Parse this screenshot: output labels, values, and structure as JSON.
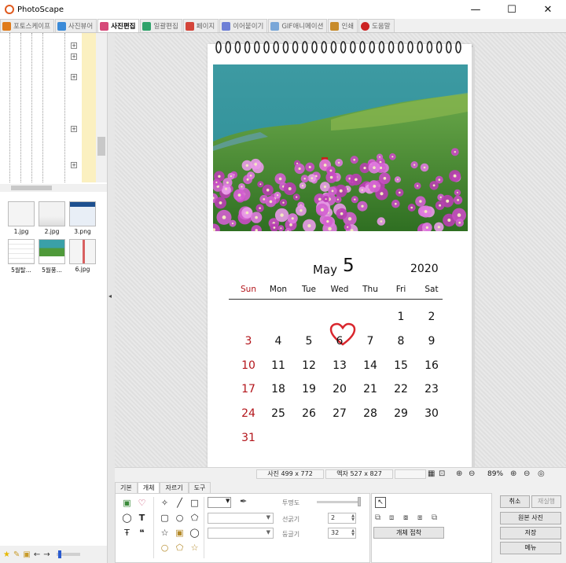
{
  "window": {
    "title": "PhotoScape",
    "controls": [
      "—",
      "☐",
      "✕"
    ]
  },
  "tabs": [
    {
      "label": "포토스케이프",
      "color": "#e07b1a"
    },
    {
      "label": "사진뷰어",
      "color": "#3b8bd8"
    },
    {
      "label": "사진편집",
      "color": "#d64a7a",
      "active": true
    },
    {
      "label": "일괄편집",
      "color": "#2fa36b"
    },
    {
      "label": "페이지",
      "color": "#d4453a"
    },
    {
      "label": "이어붙이기",
      "color": "#6d7fd6"
    },
    {
      "label": "GIF애니메이션",
      "color": "#7aa7d8"
    },
    {
      "label": "인쇄",
      "color": "#c88b2a"
    },
    {
      "label": "도움말",
      "color": "#cc2222"
    }
  ],
  "thumbnails": [
    {
      "label": "1.jpg"
    },
    {
      "label": "2.jpg"
    },
    {
      "label": "3.png"
    },
    {
      "label": "5월탈..."
    },
    {
      "label": "5월풍..."
    },
    {
      "label": "6.jpg"
    }
  ],
  "calendar": {
    "month": "May",
    "day": "5",
    "year": "2020",
    "weekdays": [
      "Sun",
      "Mon",
      "Tue",
      "Wed",
      "Thu",
      "Fri",
      "Sat"
    ],
    "weeks": [
      [
        "",
        "",
        "",
        "",
        "",
        "1",
        "2"
      ],
      [
        "3",
        "4",
        "5",
        "6",
        "7",
        "8",
        "9"
      ],
      [
        "10",
        "11",
        "12",
        "13",
        "14",
        "15",
        "16"
      ],
      [
        "17",
        "18",
        "19",
        "20",
        "21",
        "22",
        "23"
      ],
      [
        "24",
        "25",
        "26",
        "27",
        "28",
        "29",
        "30"
      ],
      [
        "31",
        "",
        "",
        "",
        "",
        "",
        ""
      ]
    ],
    "highlighted_date": "6",
    "sunday_color": "#b3151b"
  },
  "status": {
    "photo_size": "사진 499 x 772",
    "frame_size": "액자 527 x 827",
    "zoom": "89%"
  },
  "bottom_tabs": [
    "기본",
    "개체",
    "자르기",
    "도구"
  ],
  "properties": {
    "opacity_label": "투명도",
    "line_width_label": "선굵기",
    "line_width_value": "2",
    "roundness_label": "둥글기",
    "roundness_value": "32"
  },
  "object_panel": {
    "attach_button": "개체 접착"
  },
  "right_buttons": {
    "undo": "취소",
    "redo": "재실행",
    "original": "원본 사진",
    "save": "저장",
    "menu": "메뉴"
  }
}
